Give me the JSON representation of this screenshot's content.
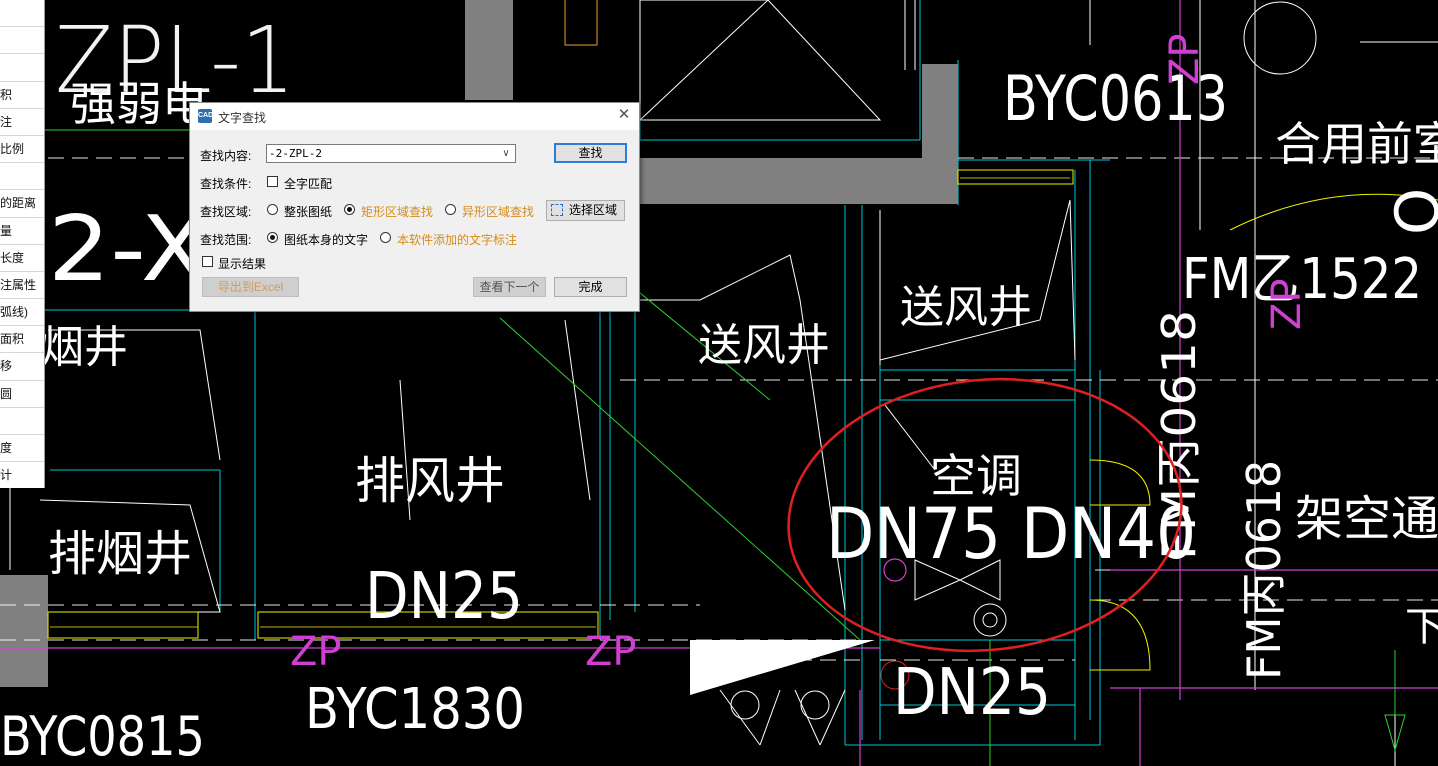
{
  "colors": {
    "background": "#000000",
    "white_lines": "#ffffff",
    "cyan_lines": "#00c8d8",
    "magenta_lines": "#d040d0",
    "yellow_lines": "#f0f000",
    "green_lines": "#30d030",
    "orange_lines": "#e8a030",
    "highlight_circle": "#e02020",
    "wall_fill": "#808080",
    "dialog_accent": "#d68b1a"
  },
  "side_panel": {
    "items": [
      "",
      "",
      "",
      "积",
      "注",
      "比例",
      "",
      "的距离",
      "量",
      "长度",
      "注属性",
      "弧线)",
      "面积",
      "移",
      "圆",
      "",
      "度",
      "计"
    ]
  },
  "drawing": {
    "labels": {
      "zpl": "ZPL-1",
      "strong_weak": "强弱电",
      "byc0613": "BYC0613",
      "shared_front": "合用前室",
      "vertical_o": "O",
      "x2": "2-X",
      "smoke_shaft_1": "烟井",
      "air_supply_1": "送风井",
      "air_supply_2": "送风井",
      "exhaust": "排风井",
      "smoke_shaft_2": "排烟井",
      "fm1522": "FM乙1522",
      "air_cond": "空调",
      "dn75_dn40": "DN75 DN40",
      "dn25_a": "DN25",
      "dn25_b": "DN25",
      "byc1830": "BYC1830",
      "byc0815": "BYC0815",
      "fm0618_a": "FM丙0618",
      "fm0618_b": "FM丙0618",
      "overhead": "架空通道",
      "zp1": "ZP",
      "zp2": "ZP",
      "zp3": "ZP",
      "zp4": "ZP",
      "xia": "下"
    }
  },
  "dialog": {
    "title": "文字查找",
    "find_label": "查找内容:",
    "find_value": "-2-ZPL-2",
    "find_button": "查找",
    "condition_label": "查找条件:",
    "whole_word": "全字匹配",
    "area_label": "查找区域:",
    "area_options": [
      "整张图纸",
      "矩形区域查找",
      "异形区域查找"
    ],
    "select_area_button": "选择区域",
    "scope_label": "查找范围:",
    "scope_options": [
      "图纸本身的文字",
      "本软件添加的文字标注"
    ],
    "show_results": "显示结果",
    "export_button": "导出到Excel",
    "next_button": "查看下一个",
    "done_button": "完成"
  }
}
